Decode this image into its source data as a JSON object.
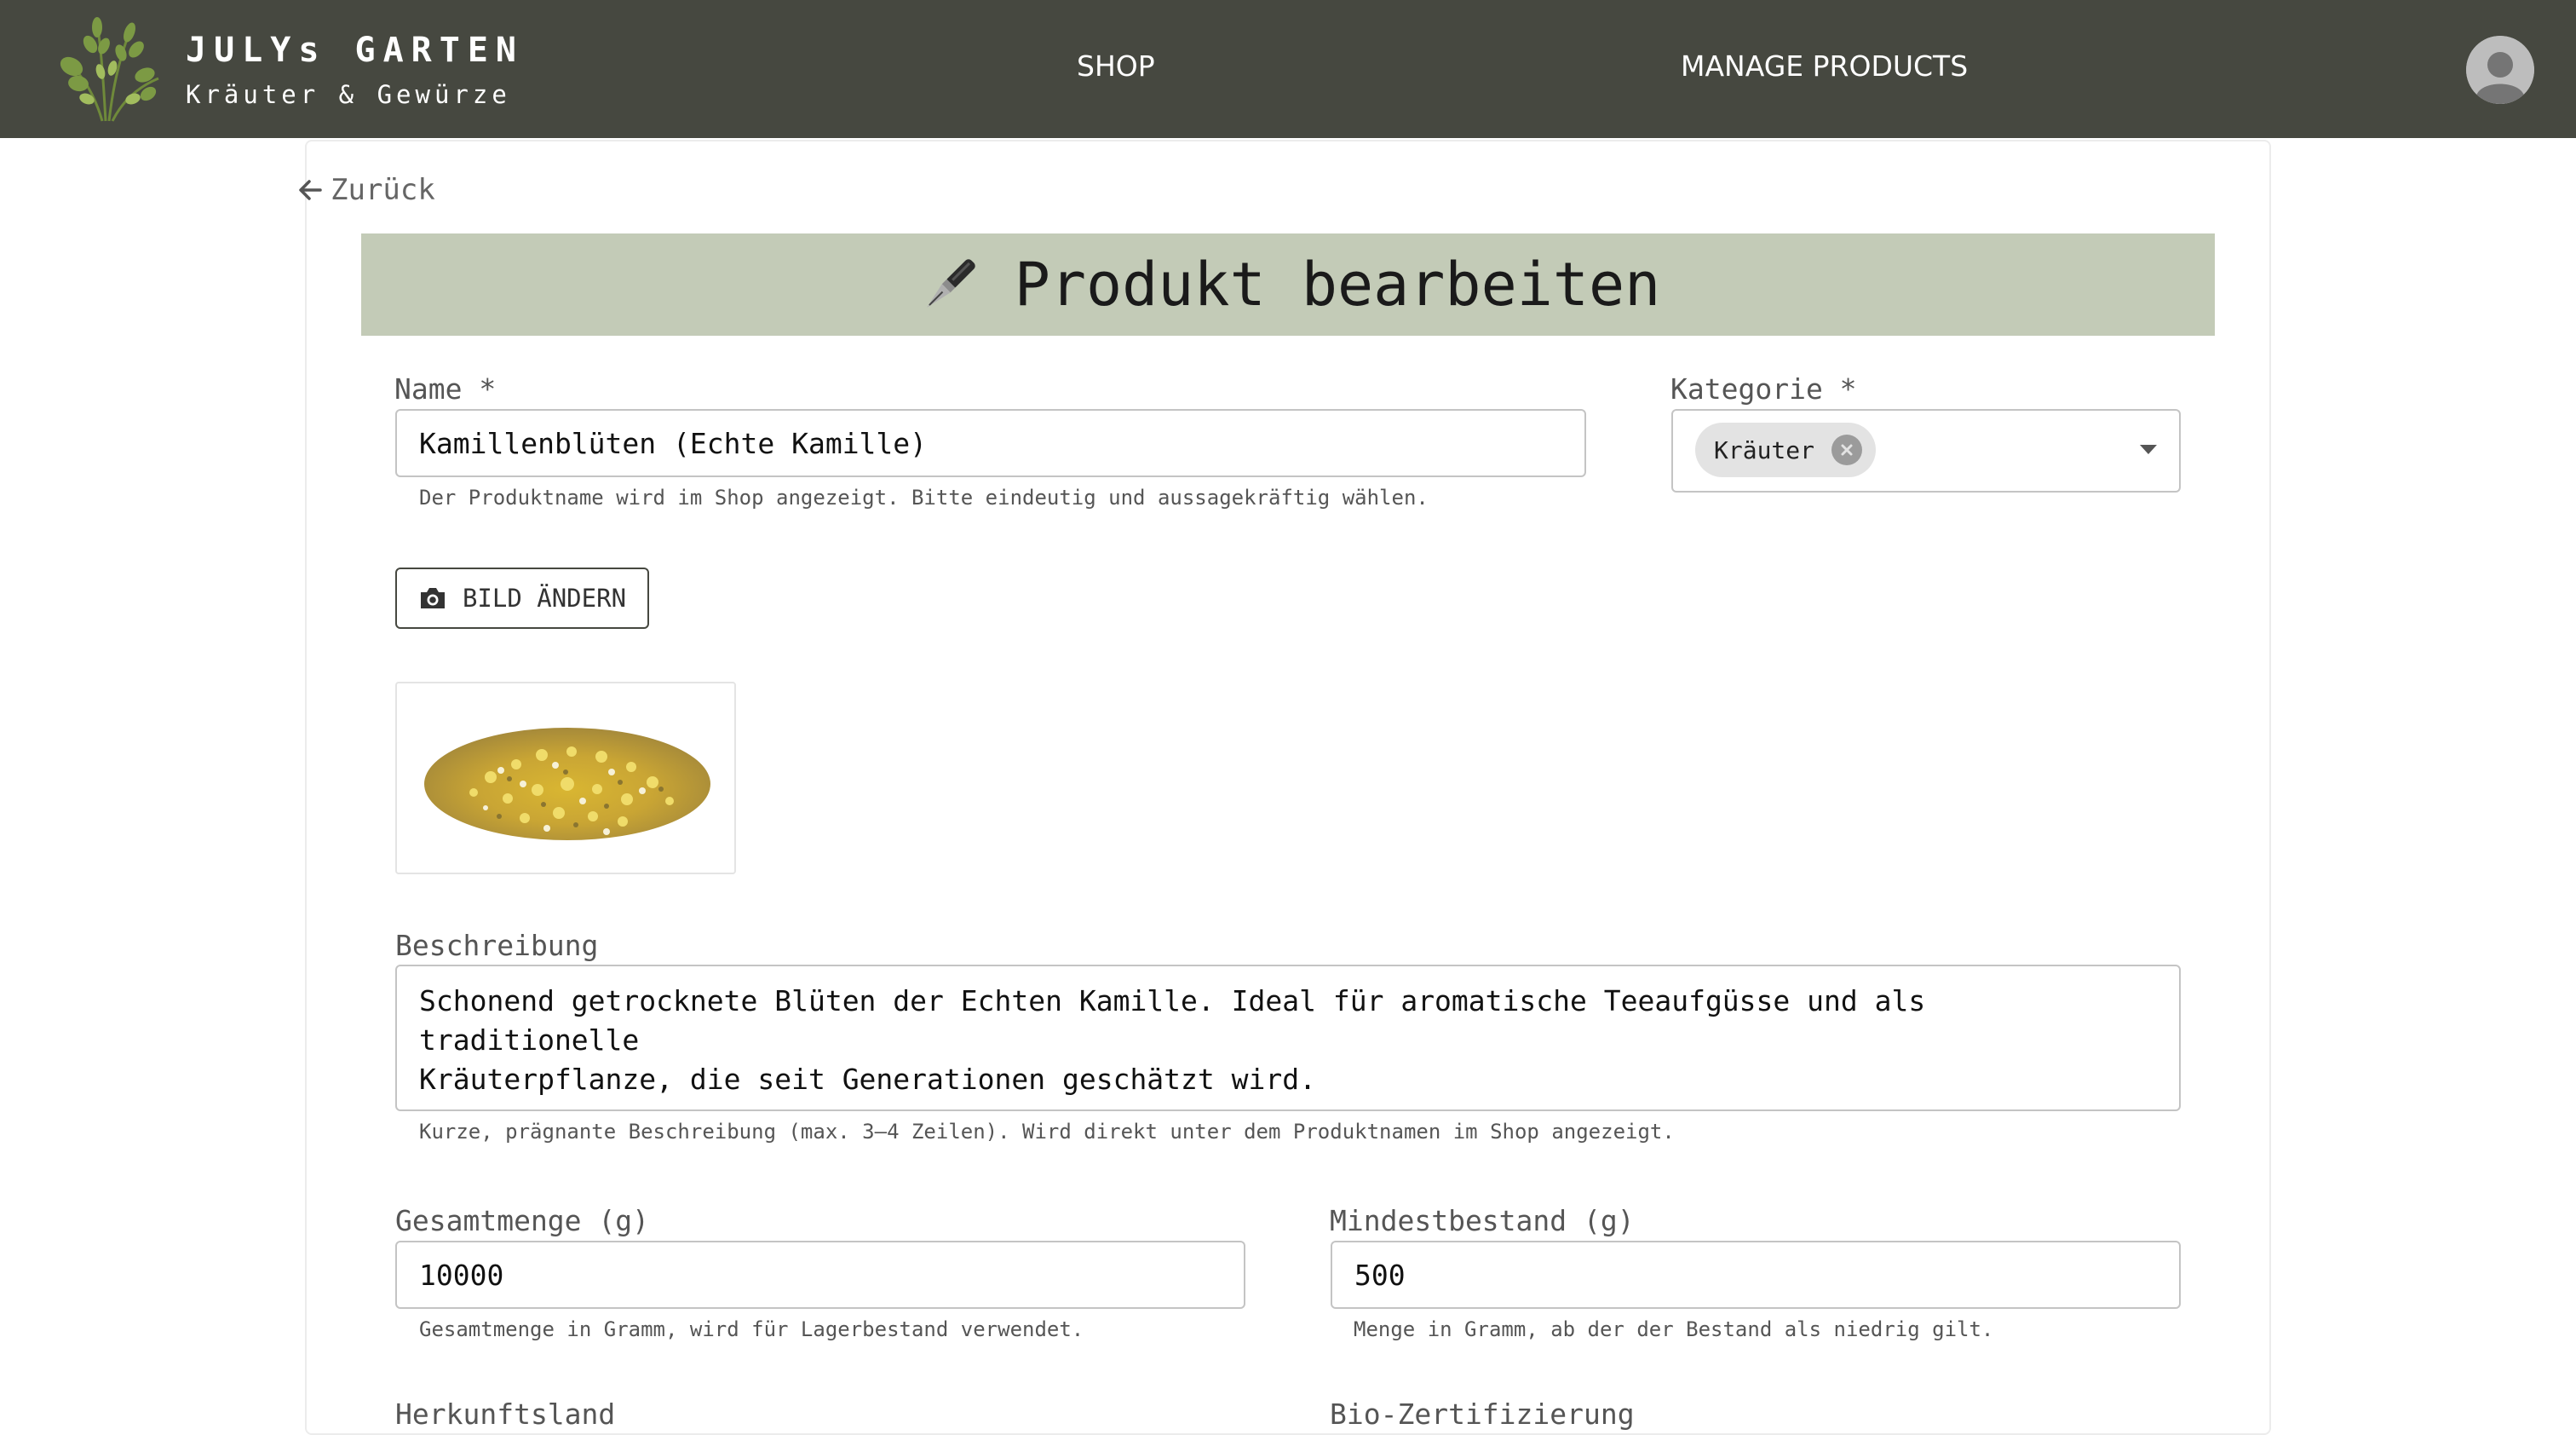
{
  "header": {
    "brand_name": "JULYs GARTEN",
    "brand_subtitle": "Kräuter & Gewürze",
    "nav": [
      {
        "label": "SHOP"
      },
      {
        "label": "MANAGE PRODUCTS"
      }
    ],
    "avatar_icon": "account-circle-icon",
    "logo_icon": "herb-bundle-logo"
  },
  "page": {
    "back_label": "Zurück",
    "title": "Produkt bearbeiten",
    "title_icon": "fountain-pen-icon"
  },
  "form": {
    "name": {
      "label": "Name *",
      "value": "Kamillenblüten (Echte Kamille)",
      "helper": "Der Produktname wird im Shop angezeigt. Bitte eindeutig und aussagekräftig wählen."
    },
    "category": {
      "label": "Kategorie *",
      "chip": "Kräuter"
    },
    "image_button": {
      "label": "BILD ÄNDERN",
      "icon": "camera-icon"
    },
    "description": {
      "label": "Beschreibung",
      "value": "Schonend getrocknete Blüten der Echten Kamille. Ideal für aromatische Teeaufgüsse und als traditionelle\nKräuterpflanze, die seit Generationen geschätzt wird.",
      "helper": "Kurze, prägnante Beschreibung (max. 3–4 Zeilen). Wird direkt unter dem Produktnamen im Shop angezeigt."
    },
    "total_amount": {
      "label": "Gesamtmenge (g)",
      "value": "10000",
      "helper": "Gesamtmenge in Gramm, wird für Lagerbestand verwendet."
    },
    "min_stock": {
      "label": "Mindestbestand (g)",
      "value": "500",
      "helper": "Menge in Gramm, ab der der Bestand als niedrig gilt."
    },
    "next_row_labels": [
      "Herkunftsland",
      "Bio-Zertifizierung"
    ]
  },
  "colors": {
    "header_bg": "#464840",
    "title_bar_bg": "#c3cbb7",
    "border": "#c4c4c4"
  }
}
